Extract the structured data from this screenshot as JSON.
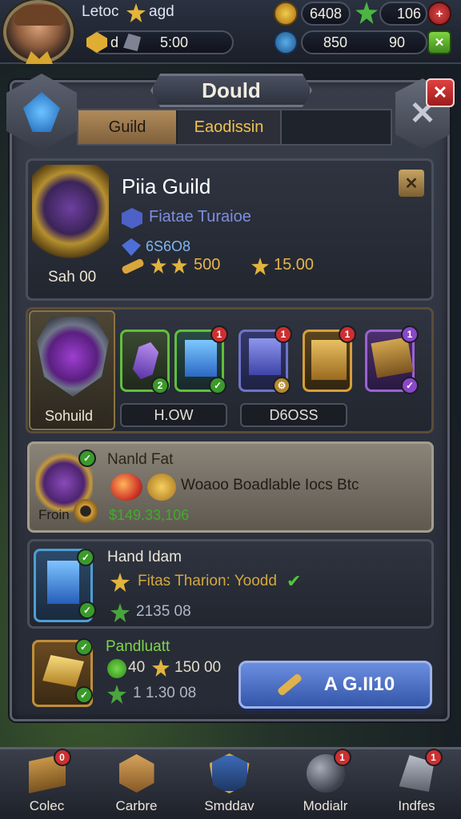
{
  "header": {
    "player_name": "Letoc",
    "player_tag": "agd",
    "energy_label": "d",
    "timer": "5:00",
    "gold": "6408",
    "gems": "106",
    "crystals": "850",
    "tokens": "90"
  },
  "dialog": {
    "title": "Dould",
    "tabs": [
      {
        "label": "Guild"
      },
      {
        "label": "Eaodissin"
      }
    ]
  },
  "guild": {
    "name": "Piia Guild",
    "subtitle": "Fiatae Turaioe",
    "power": "6S6O8",
    "stats_a": "500",
    "stats_b": "15.00",
    "emblem_label": "Sah 00"
  },
  "inventory": {
    "shield_label": "Sohuild",
    "items": [
      {
        "badge": "2"
      },
      {
        "badge": "1"
      },
      {
        "badge": "1"
      },
      {
        "badge": "1"
      },
      {
        "badge": "1"
      }
    ],
    "button_a": "H.OW",
    "button_b": "D6OSS"
  },
  "tasks": [
    {
      "title": "Nanld Fat",
      "desc": "Woaoo Boadlable Iocs Btc",
      "reward": "$149.33,106",
      "icon_label": "Froin"
    },
    {
      "title": "Hand Idam",
      "desc": "Fitas Tharion: Yoodd",
      "reward": "2135 08"
    },
    {
      "title": "Pandluatt",
      "reward_a": "40",
      "reward_b": "150 00",
      "reward_c": "1 1.30 08"
    }
  ],
  "action_button": "A G.II10",
  "nav": [
    {
      "label": "Colec",
      "badge": "0"
    },
    {
      "label": "Carbre"
    },
    {
      "label": "Smddav"
    },
    {
      "label": "Modialr",
      "badge": "1"
    },
    {
      "label": "Indfes",
      "badge": "1"
    }
  ],
  "colors": {
    "accent": "#f0c24c",
    "panel": "#2c303b",
    "green": "#5bd03c",
    "blue": "#3e6ad0"
  }
}
